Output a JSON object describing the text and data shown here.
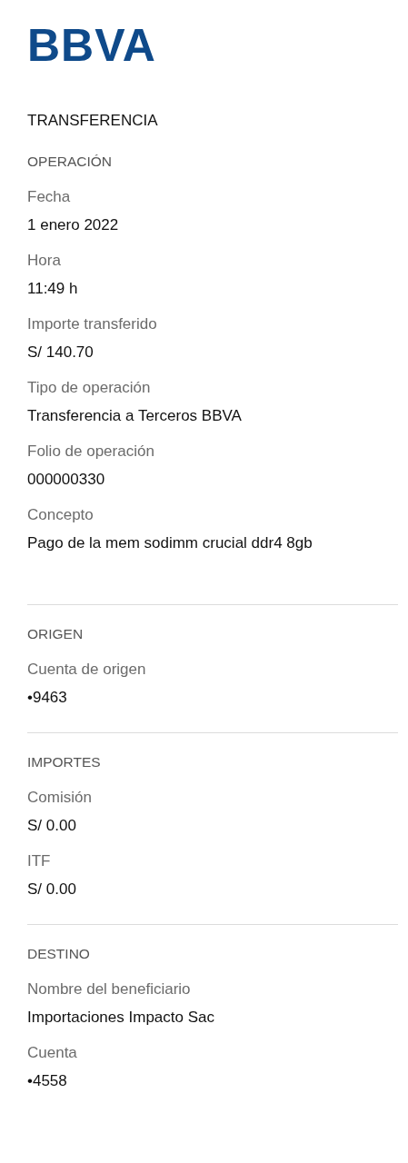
{
  "logo": "BBVA",
  "title": "TRANSFERENCIA",
  "sections": [
    {
      "heading": "OPERACIÓN",
      "fields": [
        {
          "label": "Fecha",
          "value": "1 enero 2022"
        },
        {
          "label": "Hora",
          "value": "11:49 h"
        },
        {
          "label": "Importe transferido",
          "value": "S/ 140.70"
        },
        {
          "label": "Tipo de operación",
          "value": "Transferencia a Terceros BBVA"
        },
        {
          "label": "Folio de operación",
          "value": "000000330"
        },
        {
          "label": "Concepto",
          "value": "Pago de la mem sodimm crucial ddr4 8gb"
        }
      ]
    },
    {
      "heading": "ORIGEN",
      "fields": [
        {
          "label": "Cuenta de origen",
          "value": "•9463"
        }
      ]
    },
    {
      "heading": "IMPORTES",
      "fields": [
        {
          "label": "Comisión",
          "value": "S/ 0.00"
        },
        {
          "label": "ITF",
          "value": "S/ 0.00"
        }
      ]
    },
    {
      "heading": "DESTINO",
      "fields": [
        {
          "label": "Nombre del beneficiario",
          "value": "Importaciones Impacto Sac"
        },
        {
          "label": "Cuenta",
          "value": "•4558"
        }
      ]
    }
  ]
}
